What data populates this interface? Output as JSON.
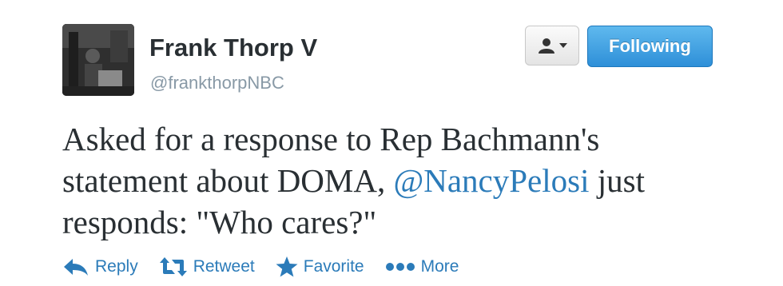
{
  "author": {
    "name": "Frank Thorp V",
    "handle": "@frankthorpNBC"
  },
  "buttons": {
    "follow_label": "Following"
  },
  "tweet": {
    "line1": "Asked for a response to Rep Bachmann's",
    "line2_before": "statement about DOMA, ",
    "mention": "@NancyPelosi",
    "line2_after": " just",
    "line3": "responds: \"Who cares?\""
  },
  "actions": {
    "reply": "Reply",
    "retweet": "Retweet",
    "favorite": "Favorite",
    "more": "More"
  },
  "colors": {
    "link": "#2b7bb9",
    "follow_button": "#2e8fd8",
    "name_text": "#292f33",
    "handle_text": "#8899a6"
  }
}
